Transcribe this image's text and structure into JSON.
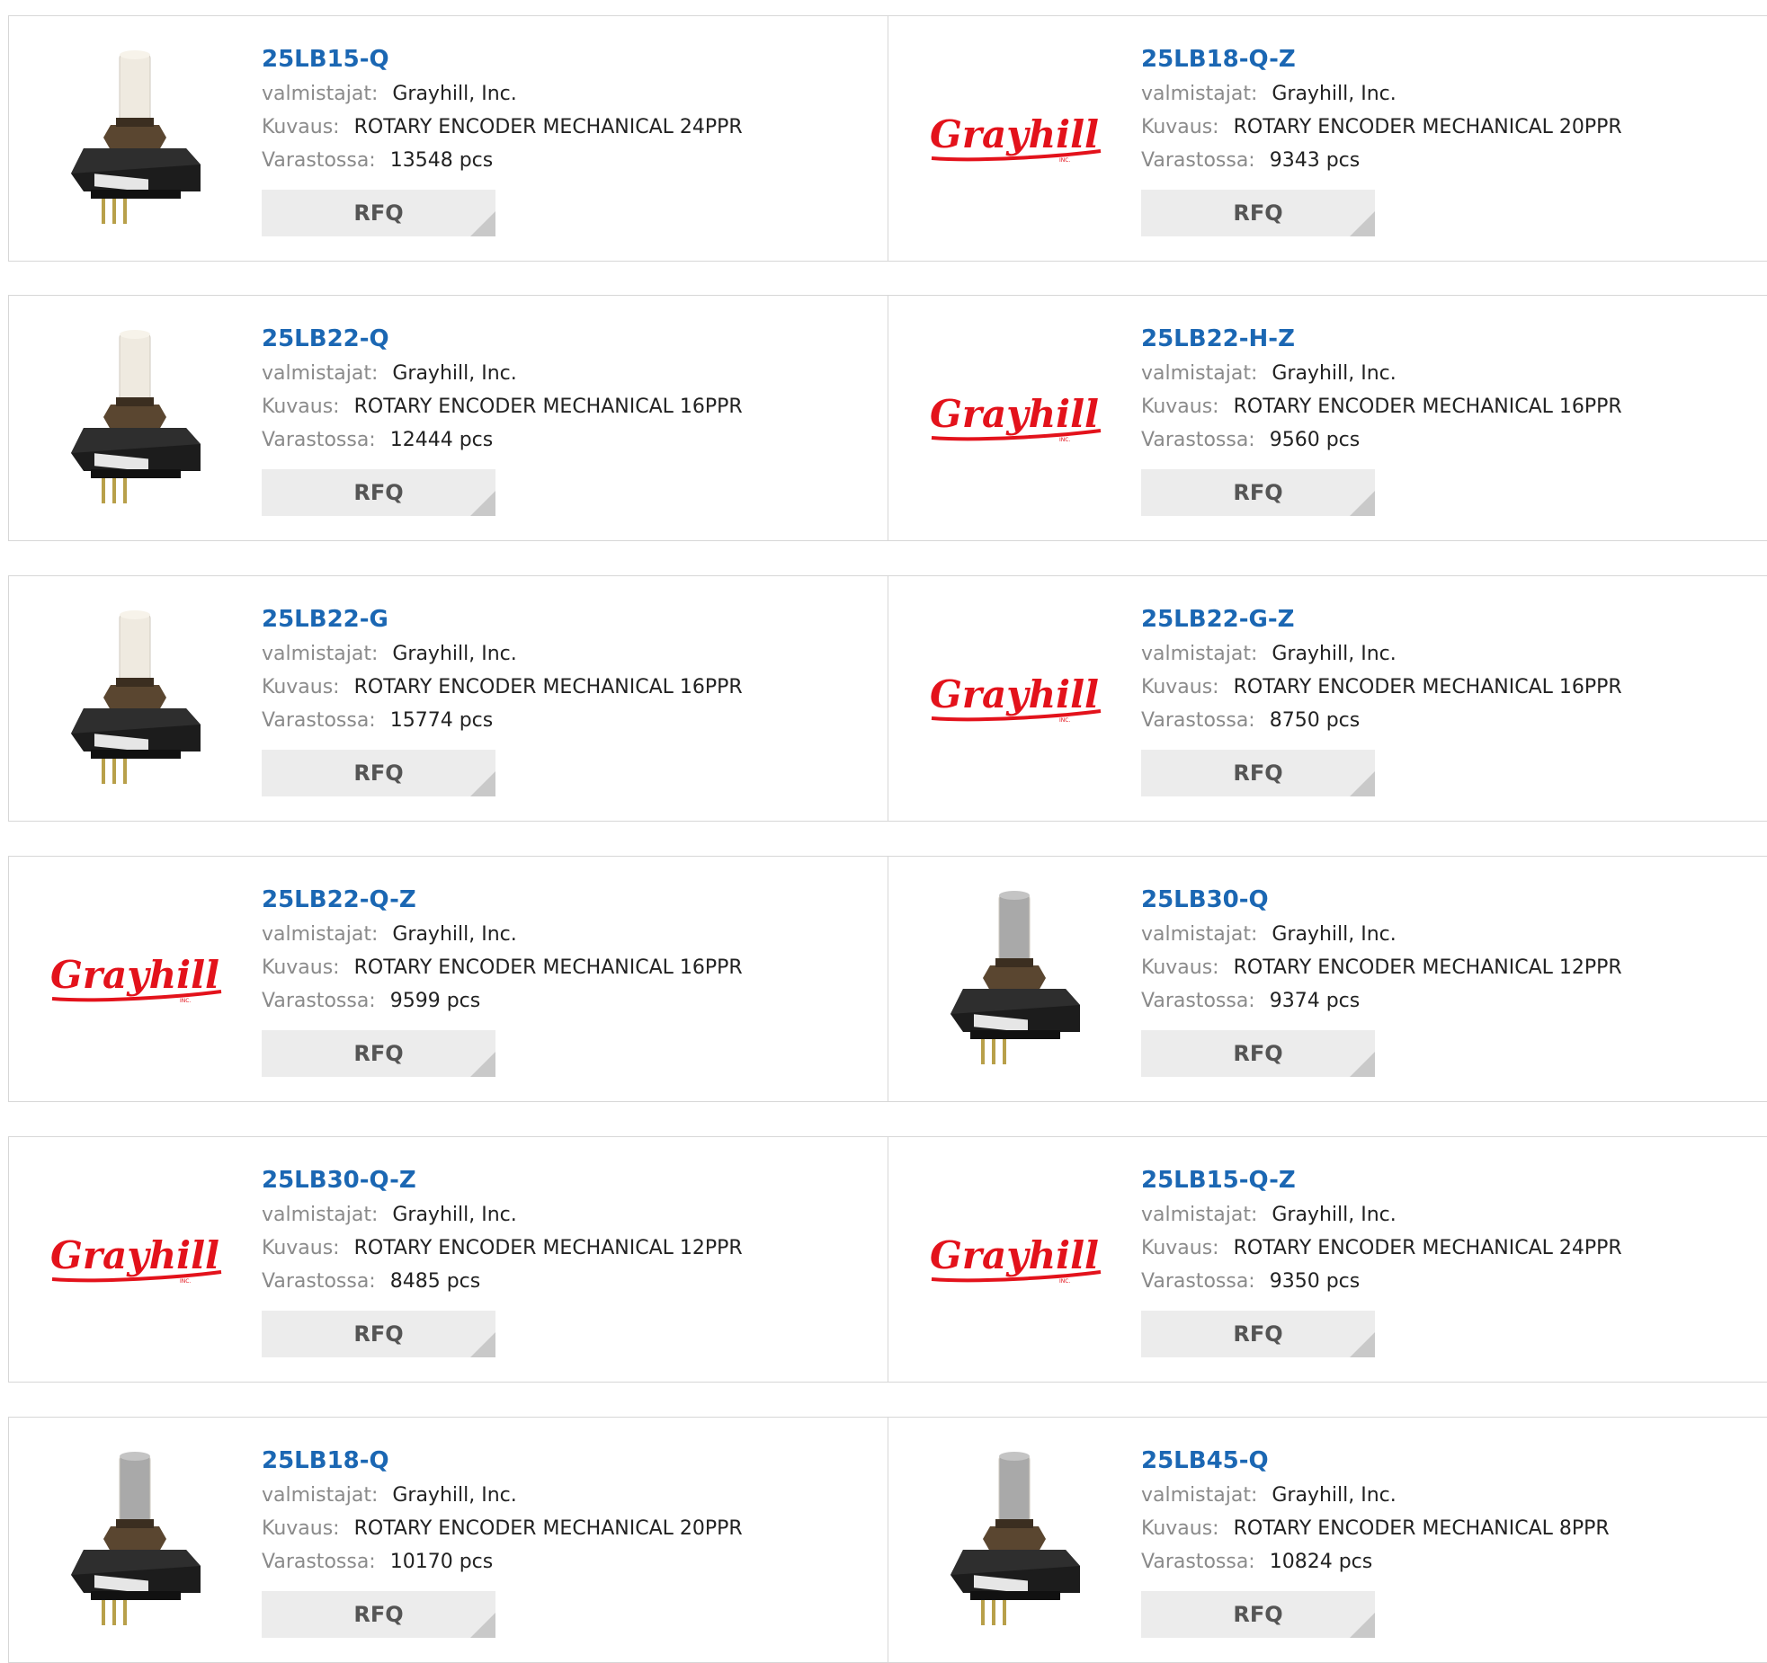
{
  "labels": {
    "manufacturer": "valmistajat:",
    "description": "Kuvaus:",
    "stock": "Varastossa:",
    "rfq": "RFQ"
  },
  "logo_text": "Grayhill",
  "products": [
    {
      "pn": "25LB15-Q",
      "mfr": "Grayhill, Inc.",
      "desc": "ROTARY ENCODER MECHANICAL 24PPR",
      "stock": "13548 pcs",
      "image": "encoder-photo"
    },
    {
      "pn": "25LB18-Q-Z",
      "mfr": "Grayhill, Inc.",
      "desc": "ROTARY ENCODER MECHANICAL 20PPR",
      "stock": "9343 pcs",
      "image": "grayhill-logo"
    },
    {
      "pn": "25LB22-Q",
      "mfr": "Grayhill, Inc.",
      "desc": "ROTARY ENCODER MECHANICAL 16PPR",
      "stock": "12444 pcs",
      "image": "encoder-photo"
    },
    {
      "pn": "25LB22-H-Z",
      "mfr": "Grayhill, Inc.",
      "desc": "ROTARY ENCODER MECHANICAL 16PPR",
      "stock": "9560 pcs",
      "image": "grayhill-logo"
    },
    {
      "pn": "25LB22-G",
      "mfr": "Grayhill, Inc.",
      "desc": "ROTARY ENCODER MECHANICAL 16PPR",
      "stock": "15774 pcs",
      "image": "encoder-photo"
    },
    {
      "pn": "25LB22-G-Z",
      "mfr": "Grayhill, Inc.",
      "desc": "ROTARY ENCODER MECHANICAL 16PPR",
      "stock": "8750 pcs",
      "image": "grayhill-logo"
    },
    {
      "pn": "25LB22-Q-Z",
      "mfr": "Grayhill, Inc.",
      "desc": "ROTARY ENCODER MECHANICAL 16PPR",
      "stock": "9599 pcs",
      "image": "grayhill-logo"
    },
    {
      "pn": "25LB30-Q",
      "mfr": "Grayhill, Inc.",
      "desc": "ROTARY ENCODER MECHANICAL 12PPR",
      "stock": "9374 pcs",
      "image": "encoder-photo-gray"
    },
    {
      "pn": "25LB30-Q-Z",
      "mfr": "Grayhill, Inc.",
      "desc": "ROTARY ENCODER MECHANICAL 12PPR",
      "stock": "8485 pcs",
      "image": "grayhill-logo"
    },
    {
      "pn": "25LB15-Q-Z",
      "mfr": "Grayhill, Inc.",
      "desc": "ROTARY ENCODER MECHANICAL 24PPR",
      "stock": "9350 pcs",
      "image": "grayhill-logo"
    },
    {
      "pn": "25LB18-Q",
      "mfr": "Grayhill, Inc.",
      "desc": "ROTARY ENCODER MECHANICAL 20PPR",
      "stock": "10170 pcs",
      "image": "encoder-photo-gray"
    },
    {
      "pn": "25LB45-Q",
      "mfr": "Grayhill, Inc.",
      "desc": "ROTARY ENCODER MECHANICAL 8PPR",
      "stock": "10824 pcs",
      "image": "encoder-photo-gray"
    }
  ],
  "colors": {
    "part_link": "#1b67b3",
    "logo_red": "#e3121b",
    "rfq_bg": "#ececec"
  }
}
